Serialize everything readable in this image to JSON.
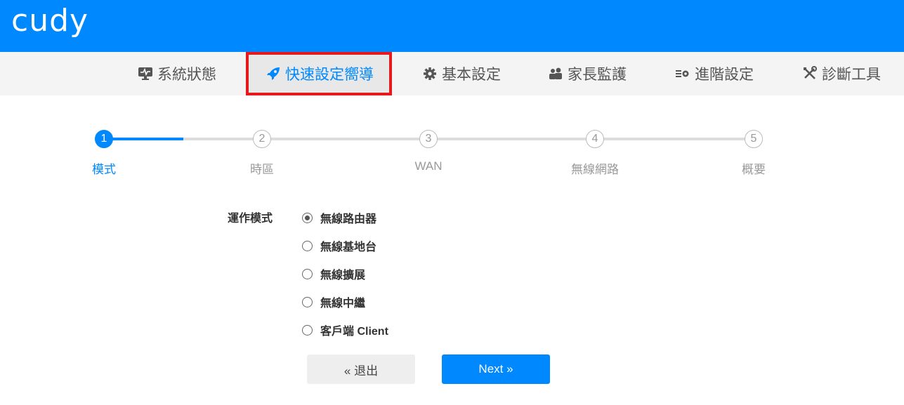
{
  "brand": {
    "logo": "cudy",
    "accent": "#0088ff",
    "highlight": "#e8191d"
  },
  "nav": {
    "items": [
      {
        "label": "系統狀態",
        "icon": "monitor-icon",
        "active": false
      },
      {
        "label": "快速設定嚮導",
        "icon": "rocket-icon",
        "active": true
      },
      {
        "label": "基本設定",
        "icon": "gear-icon",
        "active": false
      },
      {
        "label": "家長監護",
        "icon": "users-icon",
        "active": false
      },
      {
        "label": "進階設定",
        "icon": "advanced-settings-icon",
        "active": false
      },
      {
        "label": "診斷工具",
        "icon": "tools-icon",
        "active": false
      }
    ]
  },
  "wizard": {
    "current_step": 1,
    "steps": [
      {
        "number": "1",
        "label": "模式"
      },
      {
        "number": "2",
        "label": "時區"
      },
      {
        "number": "3",
        "label": "WAN"
      },
      {
        "number": "4",
        "label": "無線網路"
      },
      {
        "number": "5",
        "label": "概要"
      }
    ]
  },
  "form": {
    "mode_label": "運作模式",
    "selected": 0,
    "options": [
      {
        "label": "無線路由器"
      },
      {
        "label": "無線基地台"
      },
      {
        "label": "無線擴展"
      },
      {
        "label": "無線中繼"
      },
      {
        "label": "客戶端 Client"
      }
    ]
  },
  "buttons": {
    "exit": "« 退出",
    "next": "Next »"
  }
}
